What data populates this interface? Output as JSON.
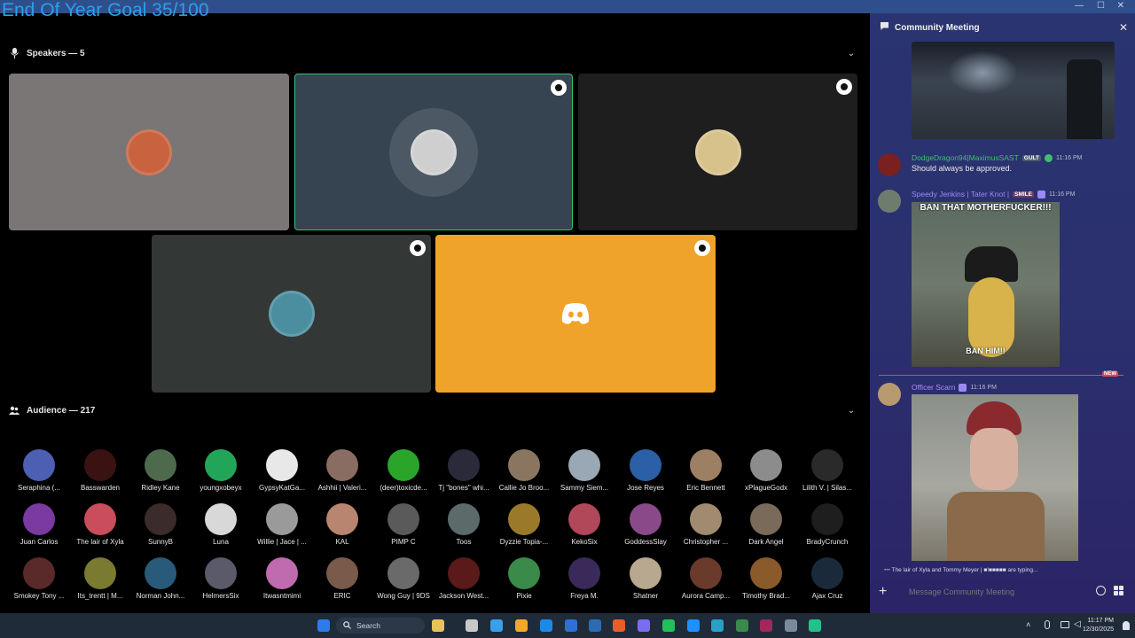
{
  "stage": {
    "speakers_header": "Speakers — 5",
    "audience_header": "Audience — 217"
  },
  "speaker_tiles": [
    {
      "id": "speaker-1",
      "bg": "#7a7675",
      "ava": "#c9633f",
      "border": "none",
      "has_badge": false
    },
    {
      "id": "speaker-2",
      "bg": "#364350",
      "ava": "#cfcfcf",
      "border": "#2dc770",
      "has_badge": true
    },
    {
      "id": "speaker-3",
      "bg": "#1f1e1e",
      "ava": "#d8c28c",
      "border": "none",
      "has_badge": true
    },
    {
      "id": "speaker-4",
      "bg": "#333836",
      "ava": "#4a8ea0",
      "border": "none",
      "has_badge": true
    },
    {
      "id": "speaker-5",
      "bg": "#f0a32a",
      "ava": "discord",
      "border": "none",
      "has_badge": true
    }
  ],
  "audience": [
    {
      "name": "Seraphina (...",
      "color": "#4d5fb2"
    },
    {
      "name": "Basswarden",
      "color": "#3a1212"
    },
    {
      "name": "Ridley Kane",
      "color": "#4d6b4c"
    },
    {
      "name": "youngxobeyx",
      "color": "#23a559"
    },
    {
      "name": "GypsyKatGa...",
      "color": "#e8e8e8"
    },
    {
      "name": "Ashhii | Valeri...",
      "color": "#8a6d62"
    },
    {
      "name": "(deer)toxicde...",
      "color": "#2aa52a"
    },
    {
      "name": "Tj \"bones\" whi...",
      "color": "#2a2a3a"
    },
    {
      "name": "Callie Jo Broo...",
      "color": "#8a7560"
    },
    {
      "name": "Sammy Siem...",
      "color": "#9aa7b4"
    },
    {
      "name": "Jose Reyes",
      "color": "#2b5fa6"
    },
    {
      "name": "Eric Bennett",
      "color": "#9d7f64"
    },
    {
      "name": "xPlagueGodx",
      "color": "#8c8c8c"
    },
    {
      "name": "Lilith V. | Silas...",
      "color": "#2a2a2a"
    },
    {
      "name": "Juan Carlos",
      "color": "#7a3aa0"
    },
    {
      "name": "The lair of Xyla",
      "color": "#c94d5b"
    },
    {
      "name": "SunnyB",
      "color": "#3b2b2b"
    },
    {
      "name": "Luna",
      "color": "#d8d8d8"
    },
    {
      "name": "Willie | Jace | ...",
      "color": "#9a9a9a"
    },
    {
      "name": "KAL",
      "color": "#b88670"
    },
    {
      "name": "PIMP C",
      "color": "#5a5a5a"
    },
    {
      "name": "Toos",
      "color": "#5d6a6a"
    },
    {
      "name": "Dyzzie Topia-...",
      "color": "#9a7a2a"
    },
    {
      "name": "KekoSix",
      "color": "#b0485a"
    },
    {
      "name": "GoddessSlay",
      "color": "#8a4a8a"
    },
    {
      "name": "Christopher ...",
      "color": "#a08a70"
    },
    {
      "name": "Dark Angel",
      "color": "#7a6a5a"
    },
    {
      "name": "BradyCrunch",
      "color": "#1e1e1e"
    },
    {
      "name": "Smokey Tony ...",
      "color": "#5a2a2a"
    },
    {
      "name": "Its_trentt | M...",
      "color": "#7a7a30"
    },
    {
      "name": "Norman John...",
      "color": "#2a5a7a"
    },
    {
      "name": "HelmersSix",
      "color": "#5a5a6a"
    },
    {
      "name": "Itwasntmimi",
      "color": "#c06ab0"
    },
    {
      "name": "ERIC",
      "color": "#7a5a4a"
    },
    {
      "name": "Wong Guy | 9DS",
      "color": "#6a6a6a"
    },
    {
      "name": "Jackson West...",
      "color": "#5a1a1a"
    },
    {
      "name": "Pixie",
      "color": "#3a8a4a"
    },
    {
      "name": "Freya M.",
      "color": "#3a2a5a"
    },
    {
      "name": "Shatner",
      "color": "#b8a890"
    },
    {
      "name": "Aurora Camp...",
      "color": "#6a3a2a"
    },
    {
      "name": "Timothy Brad...",
      "color": "#8a5a2a"
    },
    {
      "name": "Ajax Cruz",
      "color": "#1a2a3a"
    }
  ],
  "chat": {
    "title": "Community Meeting",
    "messages": [
      {
        "user": "DodgeDragon94|MaximusSAST",
        "user_color": "#3fbf6e",
        "badge": "GULT",
        "badge_color": "#4b5a70",
        "time": "11:16 PM",
        "text": "Should always be approved.",
        "avatar_color": "#7a2020"
      },
      {
        "user": "Speedy Jenkins | Tater Knot |",
        "user_color": "#9b8af5",
        "badge": "SMILE",
        "badge_color": "#6a3a6a",
        "time": "11:16 PM",
        "text": "",
        "avatar_color": "#6e7c6e",
        "image_top": "BAN THAT MOTHERFUCKER!!!",
        "image_bottom": "BAN HIM!!"
      },
      {
        "user": "Officer Scarn",
        "user_color": "#b18cf5",
        "badge": "",
        "badge_color": "",
        "time": "11:16 PM",
        "text": "",
        "avatar_color": "#b89a70"
      }
    ],
    "new_label": "NEW",
    "typing": "The lair of Xyla and Tommy Meyer | ■!■■■■■ are typing...",
    "placeholder": "Message Community Meeting"
  },
  "taskbar": {
    "overlay_text": "End Of Year Goal 35/100",
    "search_label": "Search",
    "time": "11:17 PM",
    "date": "12/30/2025"
  }
}
